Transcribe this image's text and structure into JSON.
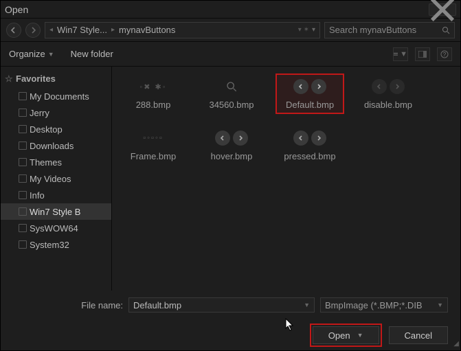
{
  "window": {
    "title": "Open"
  },
  "breadcrumb": [
    "Win7 Style...",
    "mynavButtons"
  ],
  "search": {
    "placeholder": "Search mynavButtons"
  },
  "toolbar": {
    "organize": "Organize",
    "new_folder": "New folder"
  },
  "sidebar": {
    "header": "Favorites",
    "items": [
      "My Documents",
      "Jerry",
      "Desktop",
      "Downloads",
      "Themes",
      "My Videos",
      "Info",
      "Win7 Style B",
      "SysWOW64",
      "System32"
    ]
  },
  "files": [
    {
      "name": "288.bmp"
    },
    {
      "name": "34560.bmp"
    },
    {
      "name": "Default.bmp",
      "selected": true
    },
    {
      "name": "disable.bmp"
    },
    {
      "name": "Frame.bmp"
    },
    {
      "name": "hover.bmp"
    },
    {
      "name": "pressed.bmp"
    }
  ],
  "bottom": {
    "filename_label": "File name:",
    "filename_value": "Default.bmp",
    "filetype": "BmpImage (*.BMP;*.DIB",
    "open_label": "Open",
    "cancel_label": "Cancel"
  }
}
